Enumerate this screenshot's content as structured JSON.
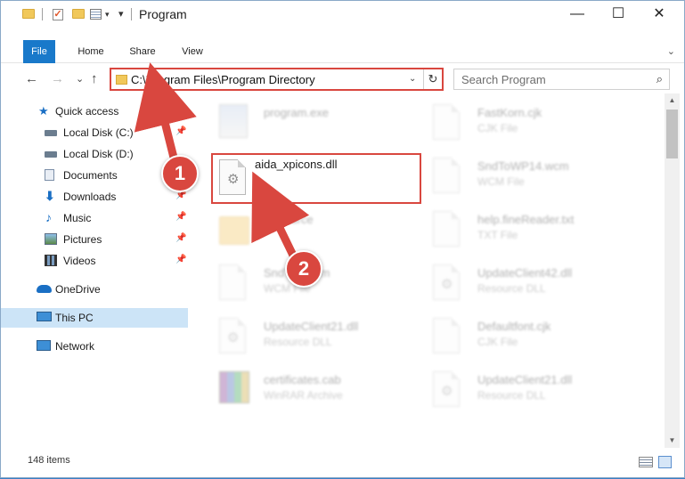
{
  "window": {
    "title": "Program",
    "minimize_glyph": "—",
    "maximize_glyph": "☐",
    "close_glyph": "✕"
  },
  "ribbon": {
    "tabs": [
      "File",
      "Home",
      "Share",
      "View"
    ],
    "expand_glyph": "⌄"
  },
  "address": {
    "path": "C:\\Program Files\\Program Directory",
    "refresh_glyph": "↻",
    "dropdown_glyph": "⌄"
  },
  "nav_buttons": {
    "back": "←",
    "forward": "→",
    "recent": "⌄",
    "up": "↑"
  },
  "search": {
    "placeholder": "Search Program",
    "icon": "⌕"
  },
  "sidebar": {
    "items": [
      {
        "label": "Quick access",
        "icon": "star-icon"
      },
      {
        "label": "Local Disk (C:)",
        "icon": "drive-icon",
        "pinned": true
      },
      {
        "label": "Local Disk (D:)",
        "icon": "drive-icon",
        "pinned": true
      },
      {
        "label": "Documents",
        "icon": "documents-icon",
        "pinned": true
      },
      {
        "label": "Downloads",
        "icon": "download-icon",
        "pinned": true
      },
      {
        "label": "Music",
        "icon": "music-icon",
        "pinned": true
      },
      {
        "label": "Pictures",
        "icon": "pictures-icon",
        "pinned": true
      },
      {
        "label": "Videos",
        "icon": "videos-icon",
        "pinned": true
      },
      {
        "label": "OneDrive",
        "icon": "cloud-icon"
      },
      {
        "label": "This PC",
        "icon": "computer-icon",
        "selected": true
      },
      {
        "label": "Network",
        "icon": "network-icon"
      }
    ],
    "pin_glyph": "📌"
  },
  "files": {
    "left": [
      {
        "name": "program.exe",
        "type": "",
        "kind": "exe"
      },
      {
        "name": "aida_xpicons.dll",
        "type": "",
        "kind": "dll",
        "highlighted": true
      },
      {
        "name": "Resource",
        "type": "",
        "kind": "folder"
      },
      {
        "name": "SndTo...wcm",
        "type": "WCM File",
        "kind": "doc"
      },
      {
        "name": "UpdateClient21.dll",
        "type": "Resource DLL",
        "kind": "dll"
      },
      {
        "name": "certificates.cab",
        "type": "WinRAR Archive",
        "kind": "rar"
      }
    ],
    "right": [
      {
        "name": "FastKorn.cjk",
        "type": "CJK File",
        "kind": "doc"
      },
      {
        "name": "SndToWP14.wcm",
        "type": "WCM File",
        "kind": "doc"
      },
      {
        "name": "help.fineReader.txt",
        "type": "TXT File",
        "kind": "doc"
      },
      {
        "name": "UpdateClient42.dll",
        "type": "Resource DLL",
        "kind": "dll"
      },
      {
        "name": "Defaultfont.cjk",
        "type": "CJK File",
        "kind": "doc"
      },
      {
        "name": "UpdateClient21.dll",
        "type": "Resource DLL",
        "kind": "dll"
      }
    ]
  },
  "status": {
    "item_count": "148 items"
  },
  "callouts": {
    "first": "1",
    "second": "2"
  },
  "colors": {
    "accent": "#1979ca",
    "highlight": "#d9473f",
    "selected": "#cce4f7"
  }
}
